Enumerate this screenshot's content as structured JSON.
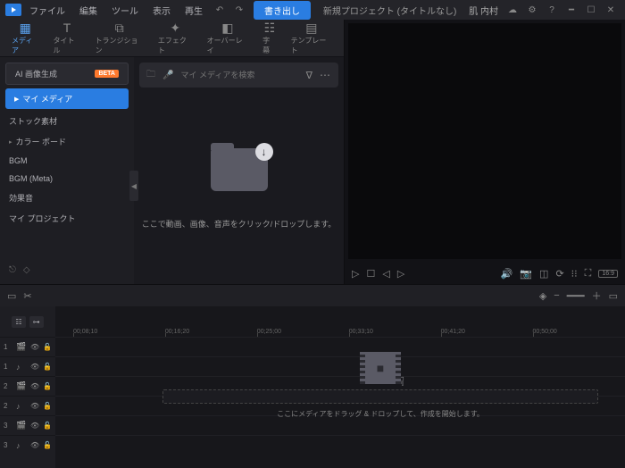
{
  "menubar": {
    "items": [
      "ファイル",
      "編集",
      "ツール",
      "表示",
      "再生"
    ],
    "export": "書き出し",
    "title": "新規プロジェクト (タイトルなし)",
    "user": "肌 内村"
  },
  "tabs": [
    {
      "label": "メディア",
      "icon": "media"
    },
    {
      "label": "タイトル",
      "icon": "title"
    },
    {
      "label": "トランジション",
      "icon": "transition"
    },
    {
      "label": "エフェクト",
      "icon": "effect"
    },
    {
      "label": "オーバーレイ",
      "icon": "overlay"
    },
    {
      "label": "字幕",
      "icon": "subtitle"
    },
    {
      "label": "テンプレート",
      "icon": "template"
    }
  ],
  "sidebar": {
    "ai": {
      "label": "AI 画像生成",
      "badge": "BETA"
    },
    "items": [
      {
        "label": "マイ メディア",
        "chev": true,
        "active": true
      },
      {
        "label": "ストック素材",
        "chev": false
      },
      {
        "label": "カラー ボード",
        "chev": true
      },
      {
        "label": "BGM",
        "chev": false
      },
      {
        "label": "BGM (Meta)",
        "chev": false
      },
      {
        "label": "効果音",
        "chev": false
      },
      {
        "label": "マイ プロジェクト",
        "chev": false
      }
    ]
  },
  "search": {
    "placeholder": "マイ メディアを検索"
  },
  "dropzone": {
    "text": "ここで動画、画像、音声をクリック/ドロップします。"
  },
  "preview": {
    "aspect": "16:9"
  },
  "timeline": {
    "ticks": [
      "00;08;10",
      "00;16;20",
      "00;25;00",
      "00;33;10",
      "00;41;20",
      "00;50;00"
    ],
    "tracks": [
      {
        "n": "1",
        "type": "video"
      },
      {
        "n": "1",
        "type": "audio"
      },
      {
        "n": "2",
        "type": "video"
      },
      {
        "n": "2",
        "type": "audio"
      },
      {
        "n": "3",
        "type": "video"
      },
      {
        "n": "3",
        "type": "audio"
      }
    ],
    "drop_text": "ここにメディアをドラッグ & ドロップして、作成を開始します。"
  }
}
